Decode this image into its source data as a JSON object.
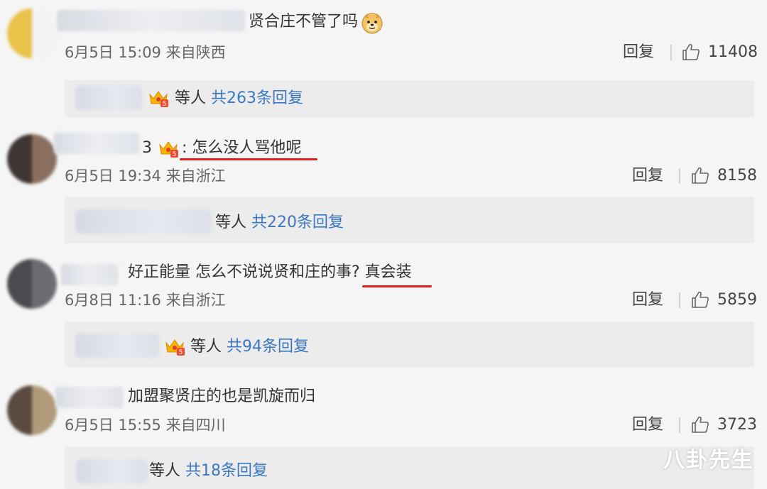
{
  "comments": [
    {
      "text_before": "",
      "text_main": "贤合庄不管了吗",
      "text_highlight": "",
      "has_emoji": true,
      "date": "6月5日 15:09 来自陕西",
      "reply_label": "回复",
      "likes": "11408",
      "sub_suffix_left": "等人",
      "sub_suffix_right": "共263条回复"
    },
    {
      "text_before": "3",
      "text_main": ":",
      "text_highlight": "怎么没人骂他呢",
      "has_emoji": false,
      "date": "6月5日 19:34 来自浙江",
      "reply_label": "回复",
      "likes": "8158",
      "sub_suffix_left": "等人",
      "sub_suffix_right": "共220条回复"
    },
    {
      "text_before": "",
      "text_main": "好正能量 怎么不说说贤和庄的事?",
      "text_highlight": "真会装",
      "has_emoji": false,
      "date": "6月8日 11:16 来自浙江",
      "reply_label": "回复",
      "likes": "5859",
      "sub_suffix_left": "等人",
      "sub_suffix_right": "共94条回复"
    },
    {
      "text_before": "",
      "text_main": "加盟聚贤庄的也是凯旋而归",
      "text_highlight": "",
      "has_emoji": false,
      "date": "6月5日 15:55 来自四川",
      "reply_label": "回复",
      "likes": "3723",
      "sub_suffix_left": "等人",
      "sub_suffix_right": "共18条回复"
    }
  ],
  "watermark": "八卦先生",
  "colors": {
    "link_blue": "#3b78c2",
    "underline_red": "#e0201c",
    "background": "#f5f5f5",
    "reply_box": "#ececec"
  },
  "icons": [
    "thumbs-up-icon",
    "crown-badge-icon",
    "doge-emoji-icon"
  ]
}
